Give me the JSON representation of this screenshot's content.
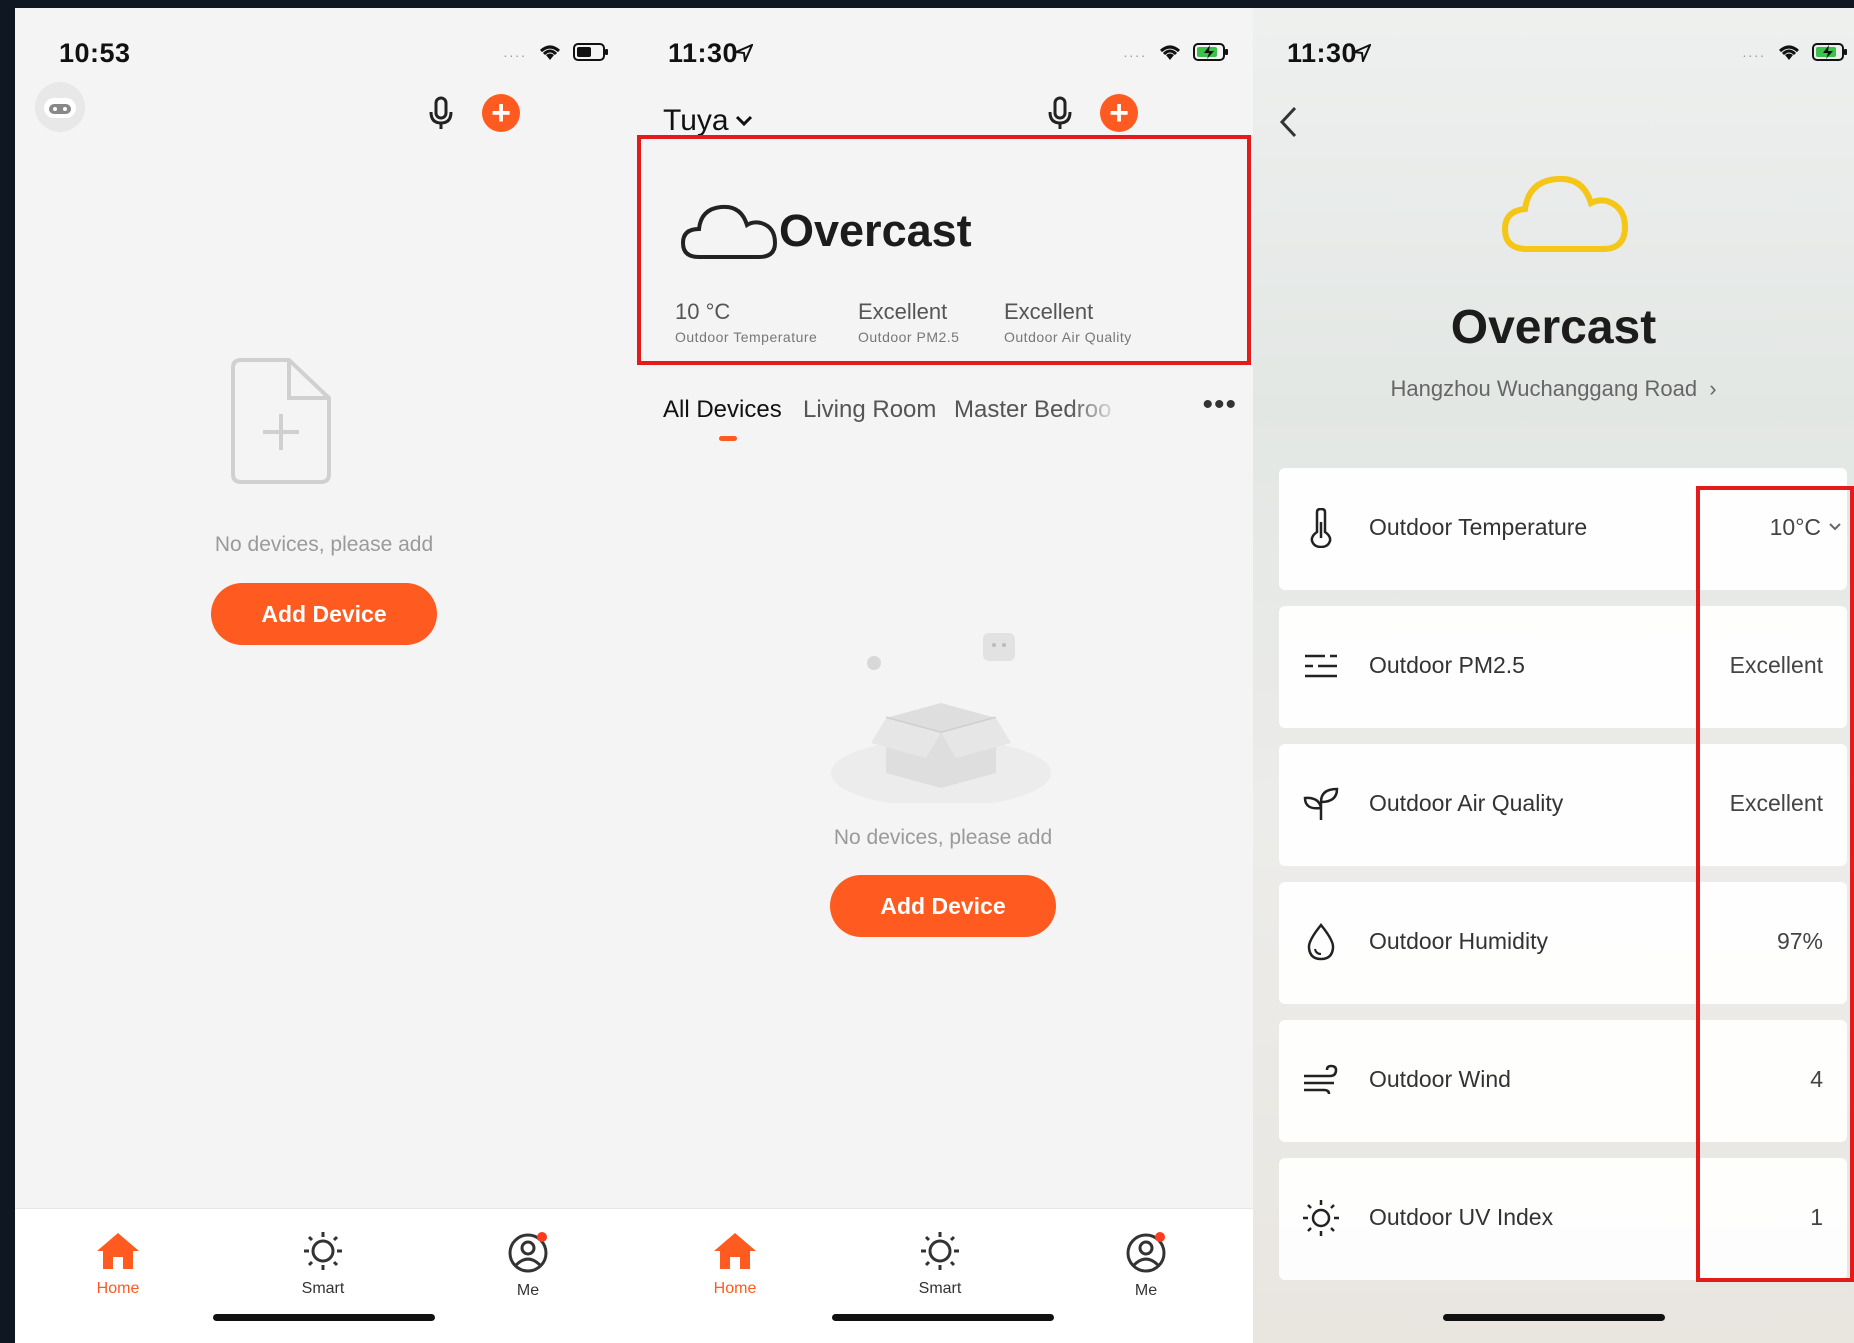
{
  "panel1": {
    "time": "10:53",
    "empty_text": "No devices, please add",
    "add_button": "Add Device"
  },
  "panel2": {
    "time": "11:30",
    "home_name": "Tuya",
    "weather": {
      "condition": "Overcast",
      "temperature": "10 °C",
      "temperature_label": "Outdoor Temperature",
      "pm25": "Excellent",
      "pm25_label": "Outdoor PM2.5",
      "air_quality": "Excellent",
      "air_quality_label": "Outdoor Air Quality"
    },
    "room_tabs": [
      "All Devices",
      "Living Room",
      "Master Bedroo"
    ],
    "empty_text": "No devices, please add",
    "add_button": "Add Device"
  },
  "panel3": {
    "time": "11:30",
    "condition": "Overcast",
    "location": "Hangzhou Wuchanggang Road",
    "rows": [
      {
        "icon": "thermometer-icon",
        "label": "Outdoor Temperature",
        "value": "10°C"
      },
      {
        "icon": "pm25-icon",
        "label": "Outdoor PM2.5",
        "value": "Excellent"
      },
      {
        "icon": "sprout-icon",
        "label": "Outdoor Air Quality",
        "value": "Excellent"
      },
      {
        "icon": "droplet-icon",
        "label": "Outdoor Humidity",
        "value": "97%"
      },
      {
        "icon": "wind-icon",
        "label": "Outdoor Wind",
        "value": "4"
      },
      {
        "icon": "sun-icon",
        "label": "Outdoor UV Index",
        "value": "1"
      }
    ]
  },
  "tabbar": {
    "home": "Home",
    "smart": "Smart",
    "me": "Me"
  },
  "colors": {
    "accent": "#ff5a1f",
    "highlight": "#e31b1b",
    "cloud_yellow": "#f5c518"
  }
}
